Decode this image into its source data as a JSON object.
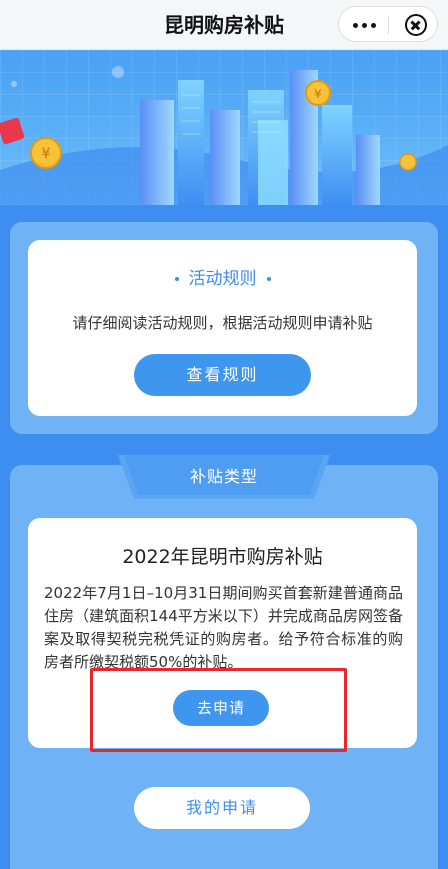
{
  "navbar": {
    "title": "昆明购房补贴",
    "more_icon": "more-dots-icon",
    "close_icon": "close-circle-icon"
  },
  "banner": {
    "illustration": "city-skyline-with-coins"
  },
  "rules": {
    "title": "活动规则",
    "description": "请仔细阅读活动规则，根据活动规则申请补贴",
    "button_label": "查看规则"
  },
  "subsidy_types": {
    "tab_label": "补贴类型",
    "card": {
      "title": "2022年昆明市购房补贴",
      "body": "2022年7月1日–10月31日期间购买首套新建普通商品住房（建筑面积144平方米以下）并完成商品房网签备案及取得契税完税凭证的购房者。给予符合标准的购房者所缴契税额50%的补贴。",
      "button_label": "去申请"
    }
  },
  "my_application": {
    "button_label": "我的申请"
  },
  "colors": {
    "accent": "#3f96ef",
    "page_bg": "#3d8ef0",
    "panel_bg": "#6fb3f6",
    "highlight_box": "#e8262b"
  }
}
